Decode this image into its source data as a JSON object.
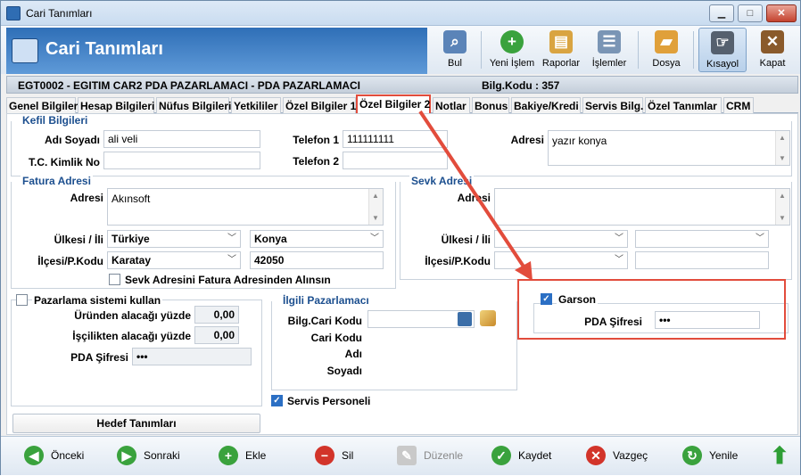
{
  "window": {
    "title": "Cari Tanımları",
    "min": "▁",
    "max": "□",
    "close": "✕"
  },
  "app": {
    "title": "Cari Tanımları"
  },
  "toolbar": {
    "buttons": [
      {
        "label": "Bul",
        "icon": "search-user-icon"
      },
      {
        "label": "Yeni İşlem",
        "icon": "plus-icon"
      },
      {
        "label": "Raporlar",
        "icon": "report-icon"
      },
      {
        "label": "İşlemler",
        "icon": "process-icon"
      },
      {
        "label": "Dosya",
        "icon": "folder-icon"
      },
      {
        "label": "Kısayol",
        "icon": "shortcut-icon"
      },
      {
        "label": "Kapat",
        "icon": "exit-door-icon"
      }
    ]
  },
  "infobar": {
    "record": "EGT0002  -  EGITIM CAR2 PDA PAZARLAMACI  -  PDA  PAZARLAMACI",
    "bilgi_kodu": "Bilg.Kodu : 357"
  },
  "tabs": [
    "Genel Bilgiler",
    "Hesap Bilgileri",
    "Nüfus Bilgileri",
    "Yetkililer",
    "Özel Bilgiler 1",
    "Özel Bilgiler 2",
    "Notlar",
    "Bonus",
    "Bakiye/Kredi",
    "Servis Bilg.",
    "Özel Tanımlar",
    "CRM"
  ],
  "kefil": {
    "group_title": "Kefil Bilgileri",
    "adi_soyadi_label": "Adı Soyadı",
    "adi_soyadi_value": "ali veli",
    "tc_label": "T.C. Kimlik No",
    "tc_value": "",
    "tel1_label": "Telefon 1",
    "tel1_value": "111111111",
    "tel2_label": "Telefon 2",
    "tel2_value": "",
    "adres_label": "Adresi",
    "adres_value": "yazır konya"
  },
  "fatura": {
    "group_title": "Fatura Adresi",
    "adres_label": "Adresi",
    "adres_value": "Akınsoft",
    "ulke_il_label": "Ülkesi / İli",
    "ulke_value": "Türkiye",
    "il_value": "Konya",
    "ilce_label": "İlçesi/P.Kodu",
    "ilce_value": "Karatay",
    "pkodu_value": "42050",
    "sevk_check_label": "Sevk Adresini Fatura Adresinden Alınsın"
  },
  "sevk": {
    "group_title": "Sevk Adresi",
    "adres_label": "Adresi",
    "adres_value": "",
    "ulke_il_label": "Ülkesi / İli",
    "ilce_label": "İlçesi/P.Kodu"
  },
  "pazarlama": {
    "check_label": "Pazarlama sistemi kullan",
    "urun_label": "Üründen alacağı yüzde",
    "urun_value": "0,00",
    "iscilik_label": "İşçilikten alacağı yüzde",
    "iscilik_value": "0,00",
    "pda_label": "PDA Şifresi",
    "pda_value": "•••",
    "hedef_button": "Hedef Tanımları"
  },
  "ilgili": {
    "group_title": "İlgili Pazarlamacı",
    "bilg_label": "Bilg.Cari Kodu",
    "cari_kodu_label": "Cari Kodu",
    "adi_label": "Adı",
    "soyadi_label": "Soyadı",
    "servis_label": "Servis Personeli"
  },
  "garson": {
    "check_label": "Garson",
    "pda_label": "PDA Şifresi",
    "pda_value": "•••"
  },
  "bottom": {
    "buttons": [
      {
        "label": "Önceki",
        "icon": "arrow-left-icon"
      },
      {
        "label": "Sonraki",
        "icon": "arrow-right-icon"
      },
      {
        "label": "Ekle",
        "icon": "plus-icon"
      },
      {
        "label": "Sil",
        "icon": "minus-icon"
      },
      {
        "label": "Düzenle",
        "icon": "edit-icon"
      },
      {
        "label": "Kaydet",
        "icon": "check-icon"
      },
      {
        "label": "Vazgeç",
        "icon": "cancel-icon"
      },
      {
        "label": "Yenile",
        "icon": "refresh-icon"
      }
    ]
  },
  "colors": {
    "accent": "#2f6fb7",
    "annotation": "#e24c3c"
  }
}
